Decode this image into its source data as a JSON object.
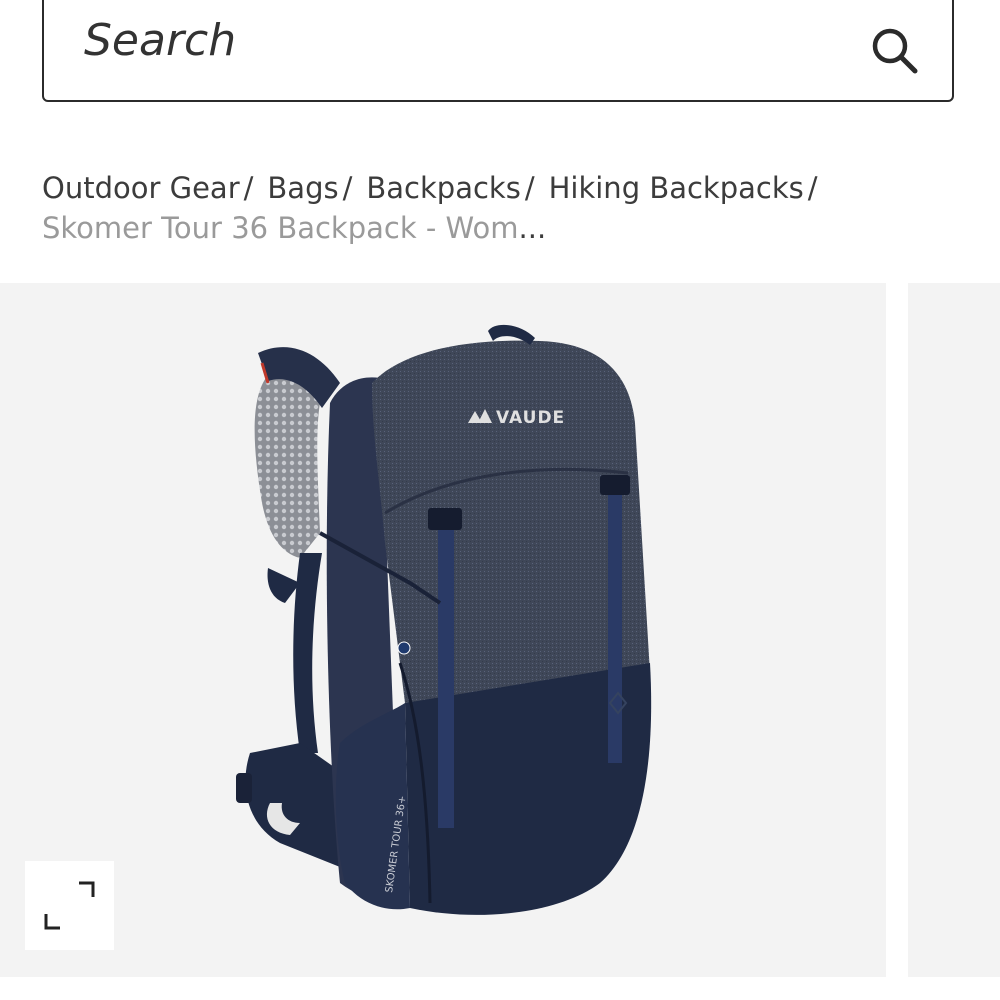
{
  "search": {
    "placeholder": "Search"
  },
  "breadcrumb": {
    "items": [
      {
        "label": "Outdoor Gear"
      },
      {
        "label": "Bags"
      },
      {
        "label": "Backpacks"
      },
      {
        "label": "Hiking Backpacks"
      }
    ],
    "separator": "/",
    "current": "Skomer Tour 36 Backpack - Wom",
    "ellipsis": "..."
  },
  "product_image": {
    "brand_logo_text": "VAUDE",
    "side_print": "SKOMER TOUR 36+"
  },
  "gallery": {
    "expand_icon": "expand-icon"
  },
  "colors": {
    "background": "#ffffff",
    "gallery_bg": "#f3f3f3",
    "text": "#3c3c3c",
    "muted_text": "#9a9a9a",
    "pack_heather": "#3d4556",
    "pack_navy": "#1f2a44"
  }
}
